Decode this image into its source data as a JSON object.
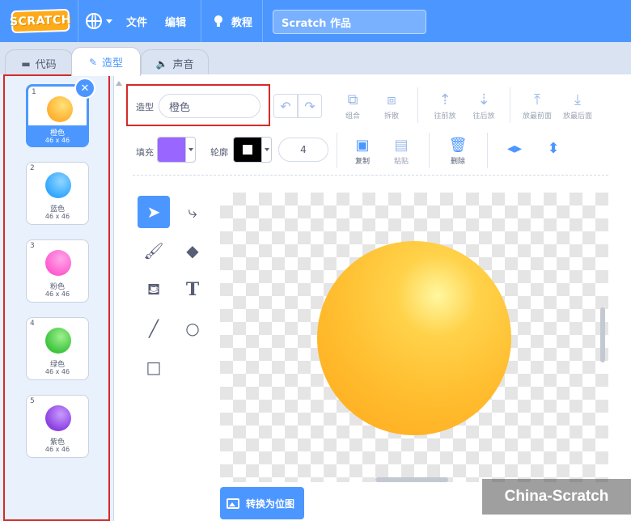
{
  "menubar": {
    "logo": "SCRATCH",
    "file": "文件",
    "edit": "编辑",
    "tutorials": "教程",
    "project_title": "Scratch 作品"
  },
  "tabs": [
    {
      "label": "代码",
      "icon": "code-icon"
    },
    {
      "label": "造型",
      "icon": "brush-icon"
    },
    {
      "label": "声音",
      "icon": "speaker-icon"
    }
  ],
  "costumes": [
    {
      "num": "1",
      "name": "橙色",
      "size": "46 x 46",
      "color": "#ffb02e"
    },
    {
      "num": "2",
      "name": "蓝色",
      "size": "46 x 46",
      "color": "#33a6ff"
    },
    {
      "num": "3",
      "name": "粉色",
      "size": "46 x 46",
      "color": "#ff5ccf"
    },
    {
      "num": "4",
      "name": "绿色",
      "size": "46 x 46",
      "color": "#3cc43c"
    },
    {
      "num": "5",
      "name": "紫色",
      "size": "46 x 46",
      "color": "#8a3fe0"
    }
  ],
  "editor": {
    "costume_label": "造型",
    "costume_name": "橙色",
    "group": "组合",
    "ungroup": "拆散",
    "forward": "往前放",
    "backward": "往后放",
    "front": "放最前面",
    "back": "放最后面",
    "fill_label": "填充",
    "outline_label": "轮廓",
    "outline_width": "4",
    "copy": "复制",
    "paste": "粘贴",
    "delete": "删除",
    "convert_bitmap": "转换为位图",
    "fill_color": "#9966ff",
    "outline_color": "#000000"
  },
  "watermark": "China-Scratch"
}
